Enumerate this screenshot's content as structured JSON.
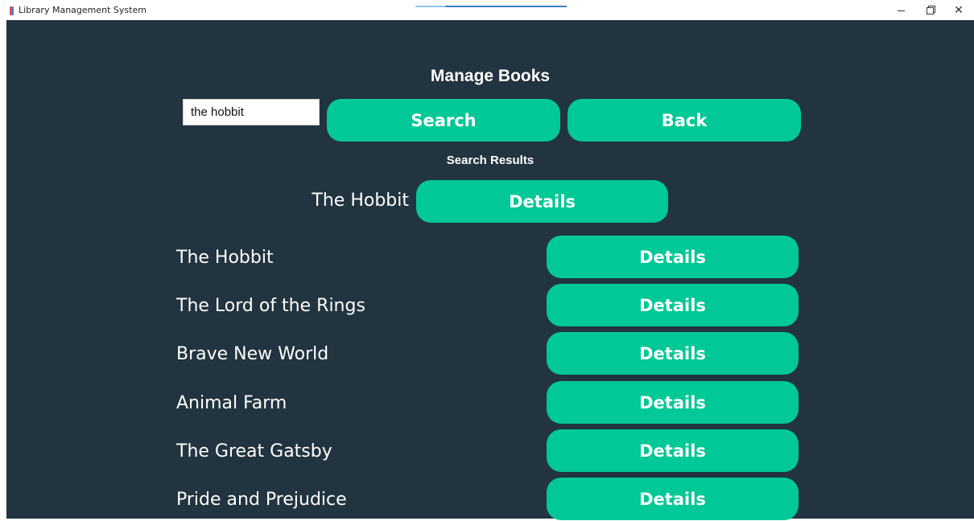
{
  "window": {
    "title": "Library Management System",
    "close_glyph": "✕"
  },
  "page": {
    "heading": "Manage Books",
    "search": {
      "value": "the hobbit",
      "button_label": "Search"
    },
    "back_label": "Back",
    "results_heading": "Search Results",
    "result": {
      "title": "The Hobbit",
      "details_label": "Details"
    },
    "books": [
      {
        "title": "The Hobbit",
        "details_label": "Details"
      },
      {
        "title": "The Lord of the Rings",
        "details_label": "Details"
      },
      {
        "title": "Brave New World",
        "details_label": "Details"
      },
      {
        "title": "Animal Farm",
        "details_label": "Details"
      },
      {
        "title": "The Great Gatsby",
        "details_label": "Details"
      },
      {
        "title": "Pride and Prejudice",
        "details_label": "Details"
      }
    ]
  },
  "colors": {
    "background": "#213440",
    "button": "#00c896",
    "text": "#ffffff"
  }
}
